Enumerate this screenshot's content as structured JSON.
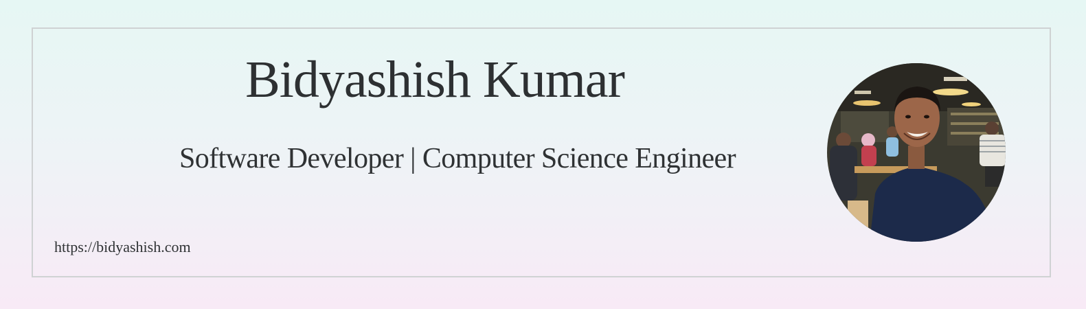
{
  "profile": {
    "name": "Bidyashish Kumar",
    "tagline": "Software Developer | Computer Science Engineer",
    "url": "https://bidyashish.com"
  },
  "colors": {
    "background_top": "#e6f7f4",
    "background_bottom": "#f8eaf6",
    "card_border": "#cfd2d3",
    "text": "#2d3032"
  },
  "avatar": {
    "icon": "profile-photo"
  }
}
